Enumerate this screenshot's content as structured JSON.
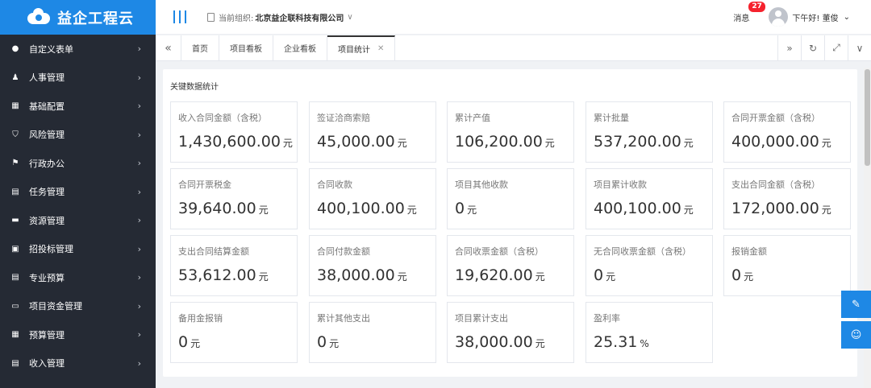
{
  "app": {
    "logo_text": "益企工程云"
  },
  "sidebar": {
    "items": [
      {
        "label": "自定义表单",
        "icon": "bulb-icon",
        "glyph": "●"
      },
      {
        "label": "人事管理",
        "icon": "user-icon",
        "glyph": "♟"
      },
      {
        "label": "基础配置",
        "icon": "grid-icon",
        "glyph": "▦"
      },
      {
        "label": "风险管理",
        "icon": "shield-icon",
        "glyph": "⛉"
      },
      {
        "label": "行政办公",
        "icon": "flag-icon",
        "glyph": "⚑"
      },
      {
        "label": "任务管理",
        "icon": "list-icon",
        "glyph": "▤"
      },
      {
        "label": "资源管理",
        "icon": "folder-icon",
        "glyph": "▬"
      },
      {
        "label": "招投标管理",
        "icon": "lock-icon",
        "glyph": "▣"
      },
      {
        "label": "专业预算",
        "icon": "document-icon",
        "glyph": "▤"
      },
      {
        "label": "项目资金管理",
        "icon": "card-icon",
        "glyph": "▭"
      },
      {
        "label": "预算管理",
        "icon": "calculator-icon",
        "glyph": "▦"
      },
      {
        "label": "收入管理",
        "icon": "document-icon",
        "glyph": "▤"
      }
    ]
  },
  "header": {
    "org_label": "当前组织:",
    "org_name": "北京益企联科技有限公司",
    "messages_label": "消息",
    "messages_count": "27",
    "greeting": "下午好! 董俊"
  },
  "tabs": [
    {
      "label": "首页",
      "active": false
    },
    {
      "label": "项目看板",
      "active": false
    },
    {
      "label": "企业看板",
      "active": false
    },
    {
      "label": "项目统计",
      "active": true
    }
  ],
  "main": {
    "section_title": "关键数据统计",
    "cards": [
      {
        "label": "收入合同金额（含税）",
        "value": "1,430,600.00",
        "unit": "元"
      },
      {
        "label": "签证洽商索赔",
        "value": "45,000.00",
        "unit": "元"
      },
      {
        "label": "累计产值",
        "value": "106,200.00",
        "unit": "元"
      },
      {
        "label": "累计批量",
        "value": "537,200.00",
        "unit": "元"
      },
      {
        "label": "合同开票金额（含税）",
        "value": "400,000.00",
        "unit": "元"
      },
      {
        "label": "合同开票税金",
        "value": "39,640.00",
        "unit": "元"
      },
      {
        "label": "合同收款",
        "value": "400,100.00",
        "unit": "元"
      },
      {
        "label": "项目其他收款",
        "value": "0",
        "unit": "元"
      },
      {
        "label": "项目累计收款",
        "value": "400,100.00",
        "unit": "元"
      },
      {
        "label": "支出合同金额（含税）",
        "value": "172,000.00",
        "unit": "元"
      },
      {
        "label": "支出合同结算金额",
        "value": "53,612.00",
        "unit": "元"
      },
      {
        "label": "合同付款金额",
        "value": "38,000.00",
        "unit": "元"
      },
      {
        "label": "合同收票金额（含税）",
        "value": "19,620.00",
        "unit": "元"
      },
      {
        "label": "无合同收票金额（含税）",
        "value": "0",
        "unit": "元"
      },
      {
        "label": "报销金额",
        "value": "0",
        "unit": "元"
      },
      {
        "label": "备用金报销",
        "value": "0",
        "unit": "元"
      },
      {
        "label": "累计其他支出",
        "value": "0",
        "unit": "元"
      },
      {
        "label": "项目累计支出",
        "value": "38,000.00",
        "unit": "元"
      },
      {
        "label": "盈利率",
        "value": "25.31",
        "unit": "%"
      }
    ]
  },
  "colors": {
    "brand": "#1e88e5",
    "sidebar_bg": "#252a34",
    "badge": "#f5222d"
  }
}
